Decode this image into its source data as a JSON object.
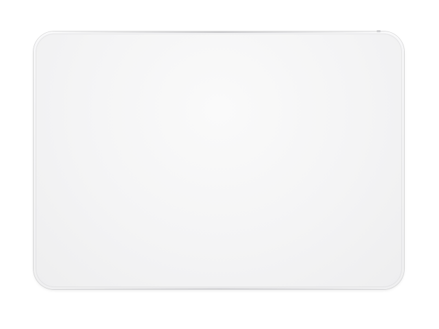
{
  "image": {
    "subject": "magic-trackpad",
    "colors": {
      "background": "#ffffff",
      "surface": "#f4f4f5",
      "edge": "#bfbfc2"
    }
  }
}
